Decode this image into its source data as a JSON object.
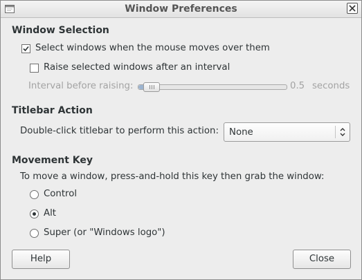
{
  "window": {
    "title": "Window Preferences"
  },
  "window_selection": {
    "heading": "Window Selection",
    "select_on_hover": {
      "label": "Select windows when the mouse moves over them",
      "checked": true
    },
    "raise_after_interval": {
      "label": "Raise selected windows after an interval",
      "checked": false
    },
    "interval": {
      "label": "Interval before raising:",
      "value": "0.5",
      "unit": "seconds",
      "level": 0.05,
      "enabled": false
    }
  },
  "titlebar_action": {
    "heading": "Titlebar Action",
    "label": "Double-click titlebar to perform this action:",
    "selected": "None"
  },
  "movement_key": {
    "heading": "Movement Key",
    "description": "To move a window, press-and-hold this key then grab the window:",
    "options": [
      {
        "label": "Control",
        "selected": false
      },
      {
        "label": "Alt",
        "selected": true
      },
      {
        "label": "Super (or \"Windows logo\")",
        "selected": false
      }
    ]
  },
  "buttons": {
    "help": "Help",
    "close": "Close"
  },
  "icons": {
    "window": "window-icon",
    "close": "close-icon",
    "check": "checkmark-icon",
    "combo": "chevron-updown-icon"
  }
}
